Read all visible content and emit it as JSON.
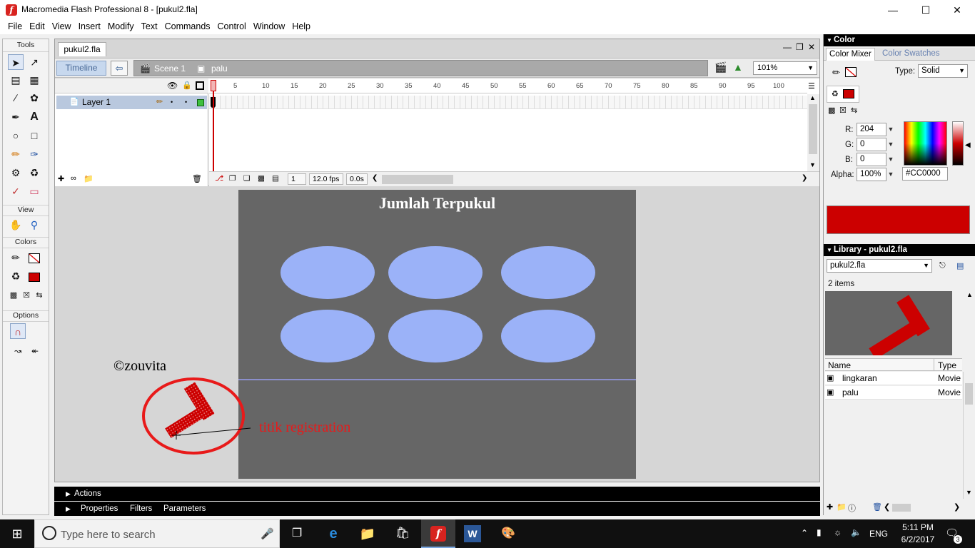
{
  "window": {
    "title": "Macromedia Flash Professional 8 - [pukul2.fla]",
    "app_icon_glyph": "f",
    "controls": [
      "minimize-icon",
      "maximize-icon",
      "close-icon"
    ]
  },
  "menu": [
    "File",
    "Edit",
    "View",
    "Insert",
    "Modify",
    "Text",
    "Commands",
    "Control",
    "Window",
    "Help"
  ],
  "tools": {
    "title": "Tools",
    "view_label": "View",
    "colors_label": "Colors",
    "options_label": "Options",
    "stroke_color": "#000000",
    "fill_color": "#CC0000"
  },
  "document": {
    "tab": "pukul2.fla",
    "timeline_button": "Timeline",
    "scene": "Scene 1",
    "symbol": "palu",
    "zoom": "101%"
  },
  "timeline": {
    "layer_name": "Layer 1",
    "frame_ticks": [
      "1",
      "5",
      "10",
      "15",
      "20",
      "25",
      "30",
      "35",
      "40",
      "45",
      "50",
      "55",
      "60",
      "65",
      "70",
      "75",
      "80",
      "85",
      "90",
      "95",
      "100"
    ],
    "current_frame": "1",
    "fps": "12.0 fps",
    "time": "0.0s"
  },
  "stage": {
    "title": "Jumlah Terpukul",
    "background": "#666666",
    "hole_color": "#9BB2F8"
  },
  "annotations": {
    "credit": "©zouvita",
    "registration_label": "titik registration"
  },
  "panels": {
    "actions": "Actions",
    "properties": "Properties",
    "filters": "Filters",
    "parameters": "Parameters"
  },
  "color_panel": {
    "title": "Color",
    "tab_mixer": "Color Mixer",
    "tab_swatches": "Color Swatches",
    "type_label": "Type:",
    "type_value": "Solid",
    "r_label": "R:",
    "r_value": "204",
    "g_label": "G:",
    "g_value": "0",
    "b_label": "B:",
    "b_value": "0",
    "alpha_label": "Alpha:",
    "alpha_value": "100%",
    "hex_value": "#CC0000"
  },
  "library": {
    "title": "Library - pukul2.fla",
    "selected_doc": "pukul2.fla",
    "count": "2 items",
    "col_name": "Name",
    "col_type": "Type",
    "items": [
      {
        "name": "lingkaran",
        "type": "Movie"
      },
      {
        "name": "palu",
        "type": "Movie"
      }
    ]
  },
  "taskbar": {
    "search_placeholder": "Type here to search",
    "language": "ENG",
    "time": "5:11 PM",
    "date": "6/2/2017",
    "notifications": "3"
  }
}
